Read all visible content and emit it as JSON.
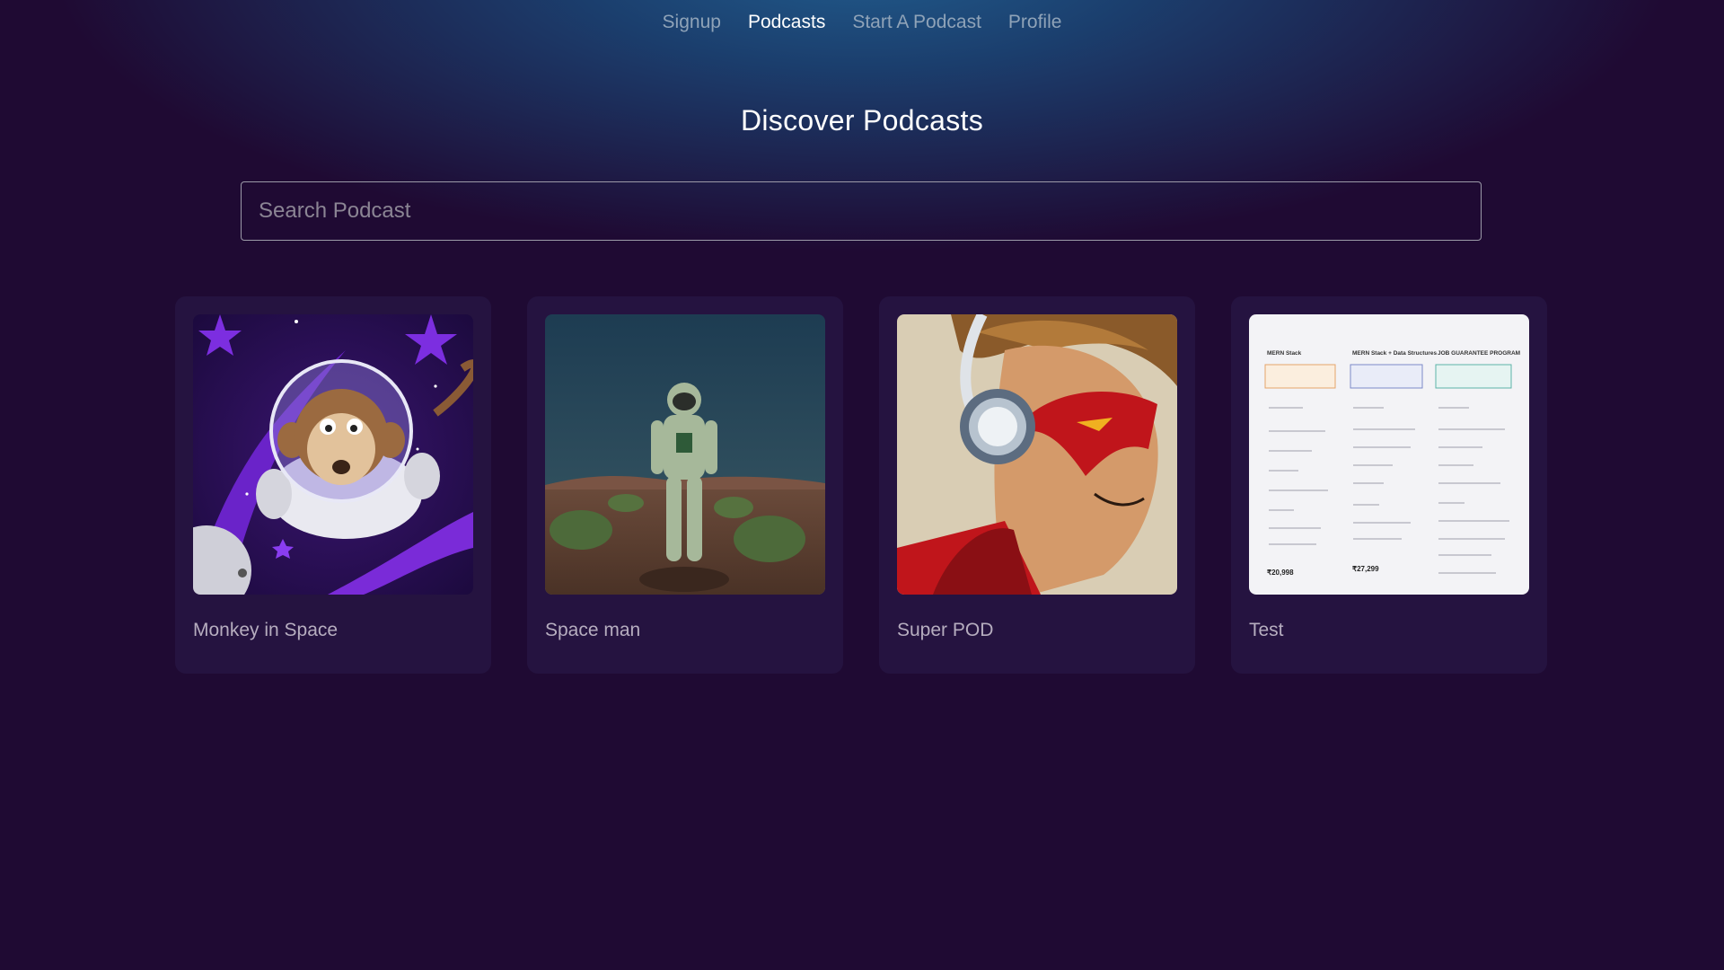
{
  "nav": {
    "items": [
      {
        "label": "Signup",
        "active": false
      },
      {
        "label": "Podcasts",
        "active": true
      },
      {
        "label": "Start A Podcast",
        "active": false
      },
      {
        "label": "Profile",
        "active": false
      }
    ]
  },
  "main": {
    "title": "Discover Podcasts",
    "search": {
      "placeholder": "Search Podcast",
      "value": ""
    }
  },
  "podcasts": [
    {
      "title": "Monkey in Space",
      "image": "monkey-astronaut-artwork"
    },
    {
      "title": "Space man",
      "image": "astronaut-desert-artwork"
    },
    {
      "title": "Super POD",
      "image": "superhero-headphones-artwork"
    },
    {
      "title": "Test",
      "image": "pricing-plans-screenshot",
      "image_text": {
        "plan_names": [
          "MERN Stack",
          "MERN Stack + Data Structures",
          "JOB GUARANTEE PROGRAM"
        ],
        "prices": [
          "₹20,998",
          "₹27,299"
        ]
      }
    }
  ],
  "colors": {
    "background": "#1f0a33",
    "header_glow": "#215b8c",
    "card": "#251340",
    "nav_active": "#ffffff",
    "nav_inactive": "#8fa3b8"
  }
}
